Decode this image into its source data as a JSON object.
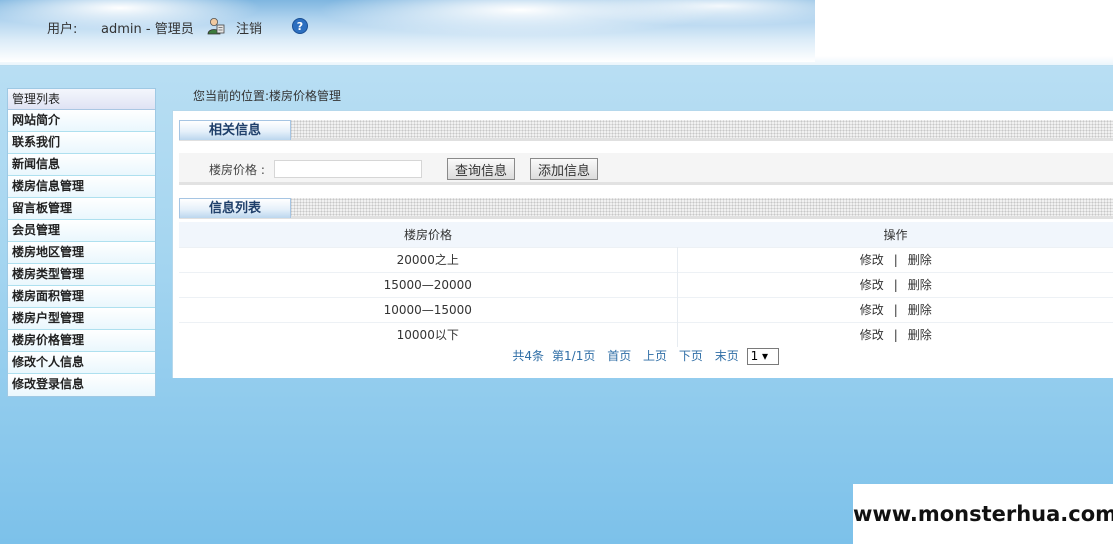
{
  "header": {
    "user_label": "用户:",
    "user_name": "admin - 管理员",
    "logout_label": "注销",
    "help_icon_glyph": "?"
  },
  "sidebar": {
    "title": "管理列表",
    "items": [
      {
        "label": "网站简介"
      },
      {
        "label": "联系我们"
      },
      {
        "label": "新闻信息"
      },
      {
        "label": "楼房信息管理"
      },
      {
        "label": "留言板管理"
      },
      {
        "label": "会员管理"
      },
      {
        "label": "楼房地区管理"
      },
      {
        "label": "楼房类型管理"
      },
      {
        "label": "楼房面积管理"
      },
      {
        "label": "楼房户型管理"
      },
      {
        "label": "楼房价格管理"
      },
      {
        "label": "修改个人信息"
      },
      {
        "label": "修改登录信息"
      }
    ]
  },
  "breadcrumb": "您当前的位置:楼房价格管理",
  "search_section": {
    "title": "相关信息",
    "field_label": "楼房价格 :",
    "field_value": "",
    "search_button": "查询信息",
    "add_button": "添加信息"
  },
  "list_section": {
    "title": "信息列表",
    "columns": [
      "楼房价格",
      "操作"
    ],
    "rows": [
      {
        "price": "20000之上",
        "edit": "修改",
        "sep": "|",
        "delete": "删除"
      },
      {
        "price": "15000—20000",
        "edit": "修改",
        "sep": "|",
        "delete": "删除"
      },
      {
        "price": "10000—15000",
        "edit": "修改",
        "sep": "|",
        "delete": "删除"
      },
      {
        "price": "10000以下",
        "edit": "修改",
        "sep": "|",
        "delete": "删除"
      }
    ]
  },
  "pager": {
    "total": "共4条",
    "page_info": "第1/1页",
    "first": "首页",
    "prev": "上页",
    "next": "下页",
    "last": "末页",
    "selected_page": "1 ▾"
  },
  "watermark": "www.monsterhua.com"
}
